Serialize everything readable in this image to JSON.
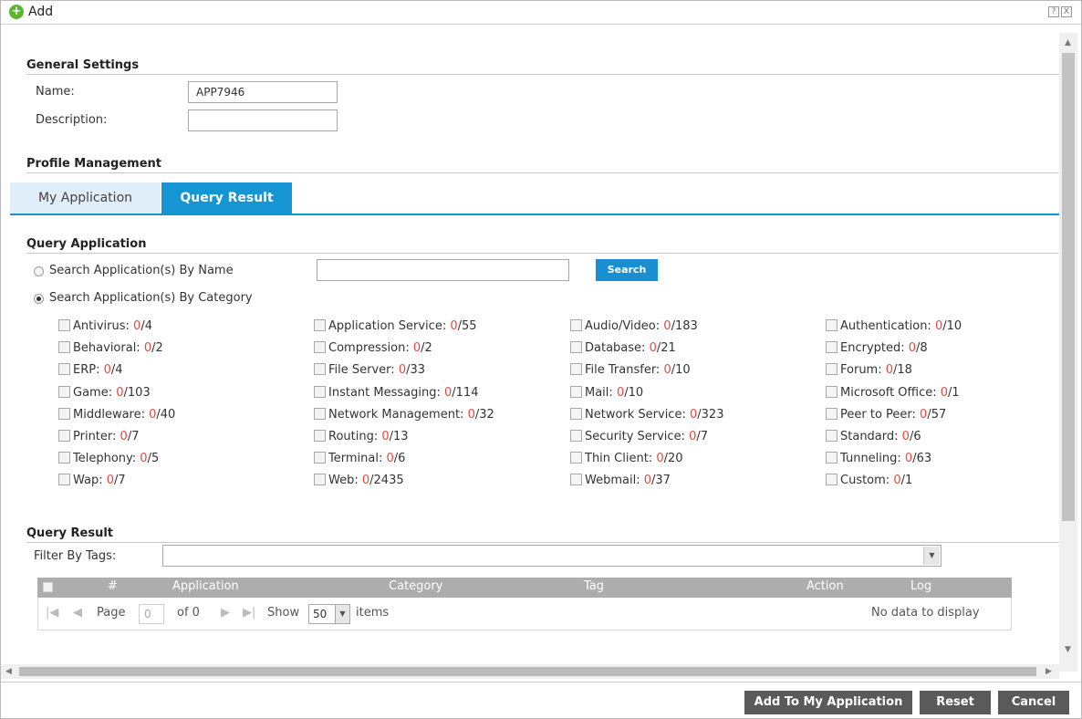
{
  "window": {
    "title": "Add",
    "help_glyph": "?",
    "close_glyph": "X"
  },
  "general": {
    "section_title": "General Settings",
    "name_label": "Name:",
    "name_value": "APP7946",
    "description_label": "Description:",
    "description_value": ""
  },
  "profile": {
    "section_title": "Profile Management",
    "tabs": [
      {
        "label": "My Application"
      },
      {
        "label": "Query Result"
      }
    ]
  },
  "query_app": {
    "section_title": "Query Application",
    "by_name_label": "Search Application(s) By Name",
    "by_category_label": "Search Application(s) By Category",
    "search_value": "",
    "search_button": "Search",
    "categories": [
      {
        "name": "Antivirus:",
        "count": "0",
        "total": "/4"
      },
      {
        "name": "Application Service:",
        "count": "0",
        "total": "/55"
      },
      {
        "name": "Audio/Video:",
        "count": "0",
        "total": "/183"
      },
      {
        "name": "Authentication:",
        "count": "0",
        "total": "/10"
      },
      {
        "name": "Behavioral:",
        "count": "0",
        "total": "/2"
      },
      {
        "name": "Compression:",
        "count": "0",
        "total": "/2"
      },
      {
        "name": "Database:",
        "count": "0",
        "total": "/21"
      },
      {
        "name": "Encrypted:",
        "count": "0",
        "total": "/8"
      },
      {
        "name": "ERP:",
        "count": "0",
        "total": "/4"
      },
      {
        "name": "File Server:",
        "count": "0",
        "total": "/33"
      },
      {
        "name": "File Transfer:",
        "count": "0",
        "total": "/10"
      },
      {
        "name": "Forum:",
        "count": "0",
        "total": "/18"
      },
      {
        "name": "Game:",
        "count": "0",
        "total": "/103"
      },
      {
        "name": "Instant Messaging:",
        "count": "0",
        "total": "/114"
      },
      {
        "name": "Mail:",
        "count": "0",
        "total": "/10"
      },
      {
        "name": "Microsoft Office:",
        "count": "0",
        "total": "/1"
      },
      {
        "name": "Middleware:",
        "count": "0",
        "total": "/40"
      },
      {
        "name": "Network Management:",
        "count": "0",
        "total": "/32"
      },
      {
        "name": "Network Service:",
        "count": "0",
        "total": "/323"
      },
      {
        "name": "Peer to Peer:",
        "count": "0",
        "total": "/57"
      },
      {
        "name": "Printer:",
        "count": "0",
        "total": "/7"
      },
      {
        "name": "Routing:",
        "count": "0",
        "total": "/13"
      },
      {
        "name": "Security Service:",
        "count": "0",
        "total": "/7"
      },
      {
        "name": "Standard:",
        "count": "0",
        "total": "/6"
      },
      {
        "name": "Telephony:",
        "count": "0",
        "total": "/5"
      },
      {
        "name": "Terminal:",
        "count": "0",
        "total": "/6"
      },
      {
        "name": "Thin Client:",
        "count": "0",
        "total": "/20"
      },
      {
        "name": "Tunneling:",
        "count": "0",
        "total": "/63"
      },
      {
        "name": "Wap:",
        "count": "0",
        "total": "/7"
      },
      {
        "name": "Web:",
        "count": "0",
        "total": "/2435"
      },
      {
        "name": "Webmail:",
        "count": "0",
        "total": "/37"
      },
      {
        "name": "Custom:",
        "count": "0",
        "total": "/1"
      }
    ]
  },
  "query_result": {
    "section_title": "Query Result",
    "filter_label": "Filter By Tags:",
    "filter_value": "",
    "columns": [
      "#",
      "Application",
      "Category",
      "Tag",
      "Action",
      "Log"
    ],
    "pager": {
      "page_label": "Page",
      "page_value": "0",
      "of_label": "of 0",
      "show_label": "Show",
      "show_value": "50",
      "items_label": "items",
      "empty_message": "No data to display"
    }
  },
  "footer": {
    "add_label": "Add To My Application",
    "reset_label": "Reset",
    "cancel_label": "Cancel"
  },
  "colors": {
    "accent": "#1595d3",
    "count_red": "#e7493e",
    "button_dark": "#5a5a5a"
  }
}
